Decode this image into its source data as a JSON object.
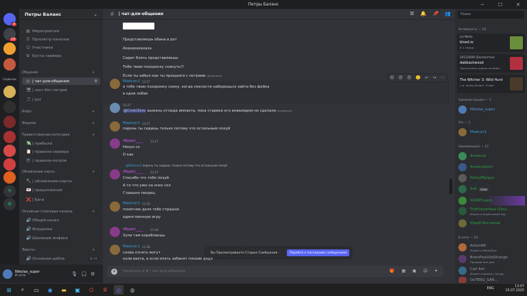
{
  "window": {
    "title": "Петры Баланс",
    "minimize": "─",
    "maximize": "☐",
    "close": "✕"
  },
  "servers": {
    "label": "Сервачок",
    "badge1": "4",
    "badge2": "19"
  },
  "server_name": "Петры Баланс",
  "channels": [
    {
      "icon": "▦",
      "label": "Мероприятия"
    },
    {
      "icon": "☰",
      "label": "Просмотр каналов"
    },
    {
      "icon": "☺",
      "label": "Участники"
    },
    {
      "icon": "✿",
      "label": "Бусты сервера"
    }
  ],
  "categories": {
    "general": "Общение",
    "info": "Инфо",
    "forums": "Форумы",
    "welcome": "Приветственная категория",
    "updates": "Обновление карты",
    "voice": "Основные голосовые каналы",
    "events": "Эвенты"
  },
  "text_channels": [
    "| чат-для-общения",
    "| хост-бот-петров",
    "| bot",
    "| прибыли",
    "| правила-сервера",
    "| правила-петров",
    "| обновление-карты",
    "| предложения",
    "| Баги",
    "Общий канал",
    "Флудилка",
    "Шалашик инфака",
    "Основная добла"
  ],
  "text_channel_icons": [
    "▤",
    "🖥",
    "🎵",
    "💸",
    "📋",
    "😎",
    "🔨",
    "💌",
    "❌",
    "🔊",
    "🔊",
    "🔊",
    "🔊"
  ],
  "voice_counts": {
    "main": "00 00"
  },
  "user": {
    "name": "Nikolas_super",
    "status": "В сети"
  },
  "header": {
    "channel": "| чат-для-общения",
    "search_placeholder": "Поиск"
  },
  "messages": {
    "m0": {
      "lines": [
        "Представляешь ебана в рот",
        "Ахахахахахаха",
        "Сидит блять представляешь",
        "Тебе твою похоронку скинуть!?",
        "Если ты забыл как ты прощался с петрами"
      ],
      "edited": "(изменено)"
    },
    "m1": {
      "author": "Madcon1",
      "time": "13:27",
      "lines": [
        "я тебе твою похоронку скину, когда смелости наберешься зайти без фейка",
        "в одни лобак"
      ]
    },
    "m2": {
      "author": "",
      "time": "13:27",
      "mention": "@CmdrZero",
      "text": " выжень отсюда импакта, пока старики его инвалидом не сделали",
      "edited": "(изменено)"
    },
    "m3": {
      "author": "Madcon1",
      "time": "13:27",
      "lines": [
        "парень ты сидишь только потому что остальным похуй"
      ]
    },
    "m4": {
      "author": "iMpakt____",
      "time": "13:27",
      "lines": [
        "Нихуя се",
        "О как"
      ]
    },
    "reply": {
      "mention": "@Madcon1",
      "text": " парень ты сидишь только потому что остальным похуй"
    },
    "m5": {
      "author": "iMpakt____",
      "time": "13:27",
      "lines": [
        "Спасибо что тебе похуй",
        "А то что уже на очко сел",
        "Страшно пиздец"
      ]
    },
    "m6": {
      "author": "Madcon1",
      "time": "13:28",
      "lines": [
        "понятное дело тебе страшно",
        "единственную игру"
      ]
    },
    "m7": {
      "author": "iMpakt____",
      "time": "13:28",
      "lines": [
        "Хули там кораблаешь"
      ]
    },
    "m8": {
      "author": "Madcon1",
      "time": "13:28",
      "lines": [
        "снова отнять могут",
        "охли вахта, а если опять забанят плохие дяди"
      ]
    }
  },
  "message_actions": [
    "😠",
    "😠",
    "😠",
    "🙂",
    "↩",
    "↪",
    "⋯"
  ],
  "jump": {
    "text": "Вы Просматриваете Старые Сообщения",
    "button": "Перейти к последним сообщениям"
  },
  "composer": {
    "placeholder": "Написать в # | чат-для-общения"
  },
  "members": {
    "activity_header": "Активность — 22",
    "activities": [
      {
        "l1": "Liz Melia",
        "l2": "bloxd.io",
        "l3": "8 ч. назад"
      },
      {
        "l1": "20122009 (Бесплатно)",
        "l2": "dabbackwood",
        "l3": "Прослушано трекое на имей..."
      },
      {
        "l1": "",
        "l2": "The Witcher 3: Wild Hunt",
        "l3": "1 д. назад  Играет: 6 мин"
      }
    ],
    "admin_header": "Администрация — 1",
    "admin": "Nikolas_super",
    "pro_header": "Pro — 1",
    "pro": "Madcon1",
    "hunters_header": "Наихвающей — 12",
    "hunters": [
      "Amiracle",
      "Amoenalium",
      "PotnyiMyrgyz",
      "Salt",
      "SORRYvaem",
      "TheForestHeal (Dios...",
      "Юрий Беспалов"
    ],
    "hunter_sub": {
      "salt": "STAR",
      "forest": "Играет в Supermarket Tog..."
    },
    "online_header": "В сети — 24",
    "online": [
      {
        "name": "Artem88",
        "sub": "Играет в RDashOne"
      },
      {
        "name": "BrainFeelsSoStrange",
        "sub": "Проведи мне дни"
      },
      {
        "name": "Carl-bot",
        "sub": "Играет в /ранка | carl.gg"
      },
      {
        "name": "DeTERG_SAN...",
        "sub": ""
      }
    ]
  },
  "taskbar": {
    "time": "13:07",
    "date": "15.07.2025",
    "lang": "ENG"
  },
  "colors": {
    "accent": "#5865f2",
    "madcon": "#3aa0d6",
    "impakt": "#d25cf0",
    "green": "#2ea043"
  }
}
